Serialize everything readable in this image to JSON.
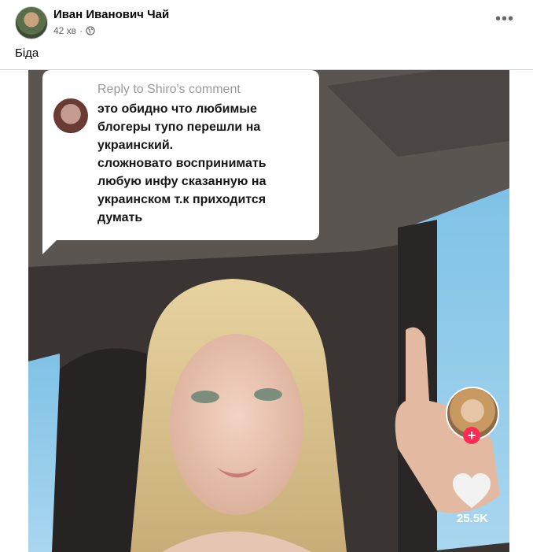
{
  "post": {
    "author": "Иван Иванович Чай",
    "time": "42 хв",
    "separator": "·",
    "text": "Біда",
    "more_label": "•••"
  },
  "media": {
    "reply_title": "Reply to Shiro's comment",
    "reply_lines": [
      "это обидно что любимые",
      "блогеры тупо перешли на",
      "украинский.",
      "сложновато воспринимать",
      "любую инфу сказанную на",
      "украинском т.к приходится",
      "думать"
    ],
    "plus": "+",
    "likes": "25.5K"
  },
  "colors": {
    "tiktok_red": "#fe2c55",
    "meta_gray": "#65676b"
  },
  "icons": {
    "privacy": "globe-icon",
    "menu": "more-options-icon",
    "like": "heart-icon"
  }
}
